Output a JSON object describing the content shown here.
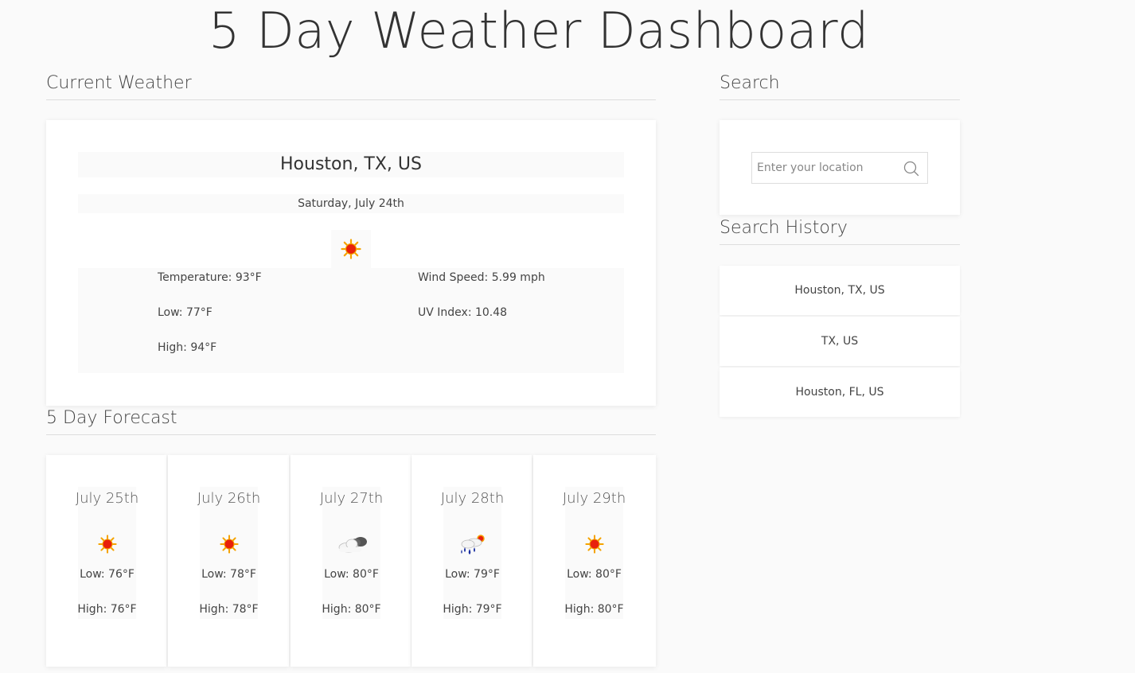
{
  "page_title": "5 Day Weather Dashboard",
  "current": {
    "heading": "Current Weather",
    "city": "Houston, TX, US",
    "date": "Saturday, July 24th",
    "icon": "sun-icon",
    "temperature": "Temperature: 93°F",
    "low": "Low: 77°F",
    "high": "High: 94°F",
    "wind": "Wind Speed: 5.99 mph",
    "uv": "UV Index: 10.48"
  },
  "search": {
    "heading": "Search",
    "placeholder": "Enter your location",
    "value": ""
  },
  "history": {
    "heading": "Search History",
    "items": [
      {
        "label": "Houston, TX, US"
      },
      {
        "label": "TX, US"
      },
      {
        "label": "Houston, FL, US"
      }
    ]
  },
  "forecast": {
    "heading": "5 Day Forecast",
    "days": [
      {
        "date": "July 25th",
        "icon": "sun-icon",
        "low": "Low: 76°F",
        "high": "High: 76°F"
      },
      {
        "date": "July 26th",
        "icon": "sun-icon",
        "low": "Low: 78°F",
        "high": "High: 78°F"
      },
      {
        "date": "July 27th",
        "icon": "cloud-icon",
        "low": "Low: 80°F",
        "high": "High: 80°F"
      },
      {
        "date": "July 28th",
        "icon": "rain-sun-icon",
        "low": "Low: 79°F",
        "high": "High: 79°F"
      },
      {
        "date": "July 29th",
        "icon": "sun-icon",
        "low": "Low: 80°F",
        "high": "High: 80°F"
      }
    ]
  },
  "colors": {
    "background": "#fafafa",
    "card": "#ffffff",
    "sun_core": "#e8200c",
    "sun_rays": "#f5a300",
    "rain": "#1a2fa0"
  }
}
